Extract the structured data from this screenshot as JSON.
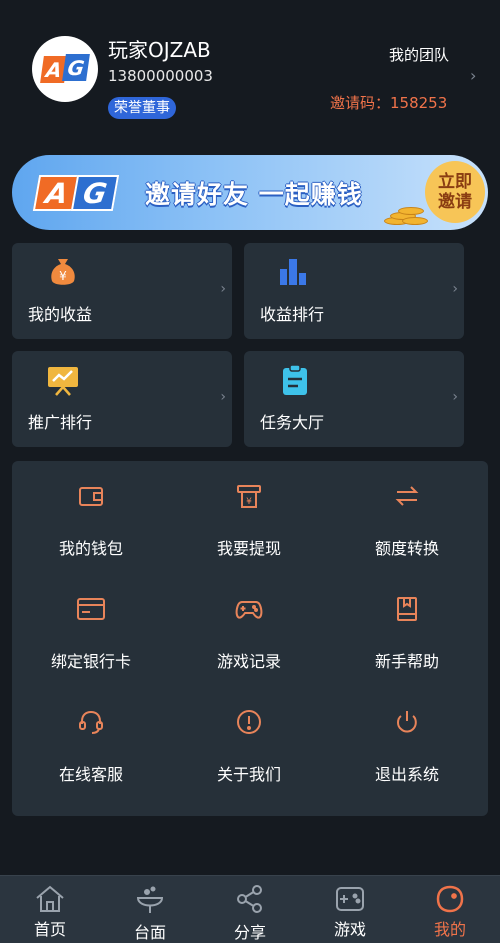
{
  "profile": {
    "username": "玩家OJZAB",
    "phone": "13800000003",
    "badge": "荣誉董事",
    "team_link": "我的团队",
    "invite_code": "邀请码：158253",
    "avatar_logo": "AG"
  },
  "banner": {
    "logo_a": "A",
    "logo_g": "G",
    "slogan": "邀请好友 一起赚钱",
    "cta_line1": "立即",
    "cta_line2": "邀请"
  },
  "cards": [
    {
      "label": "我的收益",
      "icon": "money-bag-icon"
    },
    {
      "label": "收益排行",
      "icon": "bar-chart-icon"
    },
    {
      "label": "推广排行",
      "icon": "trend-board-icon"
    },
    {
      "label": "任务大厅",
      "icon": "clipboard-icon"
    }
  ],
  "menu": [
    {
      "label": "我的钱包",
      "icon": "wallet-icon"
    },
    {
      "label": "我要提现",
      "icon": "withdraw-icon"
    },
    {
      "label": "额度转换",
      "icon": "transfer-icon"
    },
    {
      "label": "绑定银行卡",
      "icon": "bank-card-icon"
    },
    {
      "label": "游戏记录",
      "icon": "gamepad-icon"
    },
    {
      "label": "新手帮助",
      "icon": "book-icon"
    },
    {
      "label": "在线客服",
      "icon": "headset-icon"
    },
    {
      "label": "关于我们",
      "icon": "info-icon"
    },
    {
      "label": "退出系统",
      "icon": "power-icon"
    }
  ],
  "tabs": [
    {
      "label": "首页",
      "icon": "home-icon"
    },
    {
      "label": "台面",
      "icon": "table-icon"
    },
    {
      "label": "分享",
      "icon": "share-icon"
    },
    {
      "label": "游戏",
      "icon": "game-icon"
    },
    {
      "label": "我的",
      "icon": "profile-icon"
    }
  ],
  "colors": {
    "background": "#151a20",
    "card": "#263039",
    "accent": "#f0734a",
    "badge": "#2f66d9",
    "icon_stroke": "#e8845a"
  }
}
